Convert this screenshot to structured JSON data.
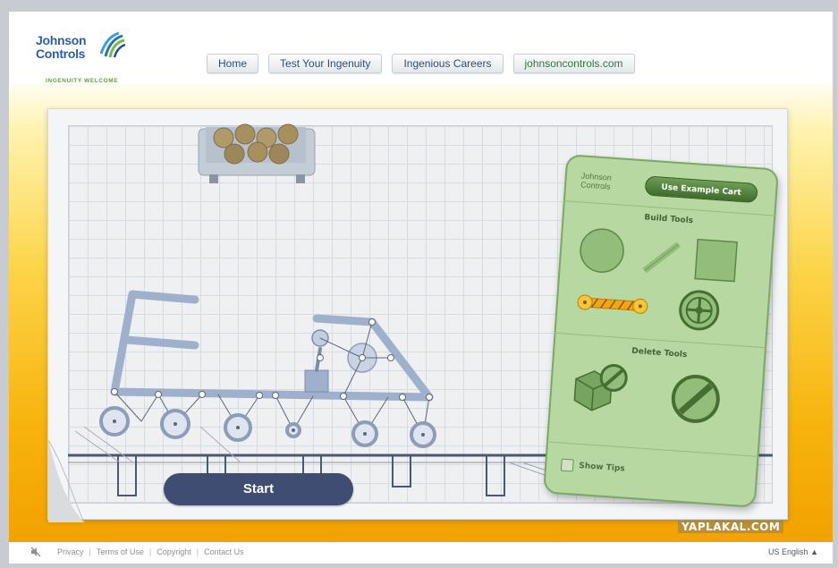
{
  "logo": {
    "line1": "Johnson",
    "line2": "Controls",
    "tagline": "INGENUITY WELCOME"
  },
  "nav": {
    "items": [
      {
        "label": "Home"
      },
      {
        "label": "Test Your Ingenuity"
      },
      {
        "label": "Ingenious Careers"
      },
      {
        "label": "johnsoncontrols.com"
      }
    ]
  },
  "game": {
    "start_label": "Start",
    "panel": {
      "logo_line1": "Johnson",
      "logo_line2": "Controls",
      "example_button": "Use Example Cart",
      "build_heading": "Build Tools",
      "delete_heading": "Delete Tools",
      "show_tips_label": "Show Tips",
      "show_tips_checked": false
    },
    "tools": [
      "wheel-tool-icon",
      "rod-tool-icon",
      "block-tool-icon",
      "spring-rod-tool-icon",
      "steering-wheel-tool-icon",
      "delete-part-icon",
      "delete-all-icon"
    ]
  },
  "footer": {
    "links": [
      "Privacy",
      "Terms of Use",
      "Copyright",
      "Contact Us"
    ],
    "language": "US English"
  },
  "watermark": "YAPLAKAL.COM",
  "colors": {
    "brand_blue": "#2b5ea7",
    "brand_green": "#5fa43a",
    "start_button": "#3f4d72",
    "panel_green": "#b8d8a2",
    "stage_yellow": "#f7b30c"
  }
}
